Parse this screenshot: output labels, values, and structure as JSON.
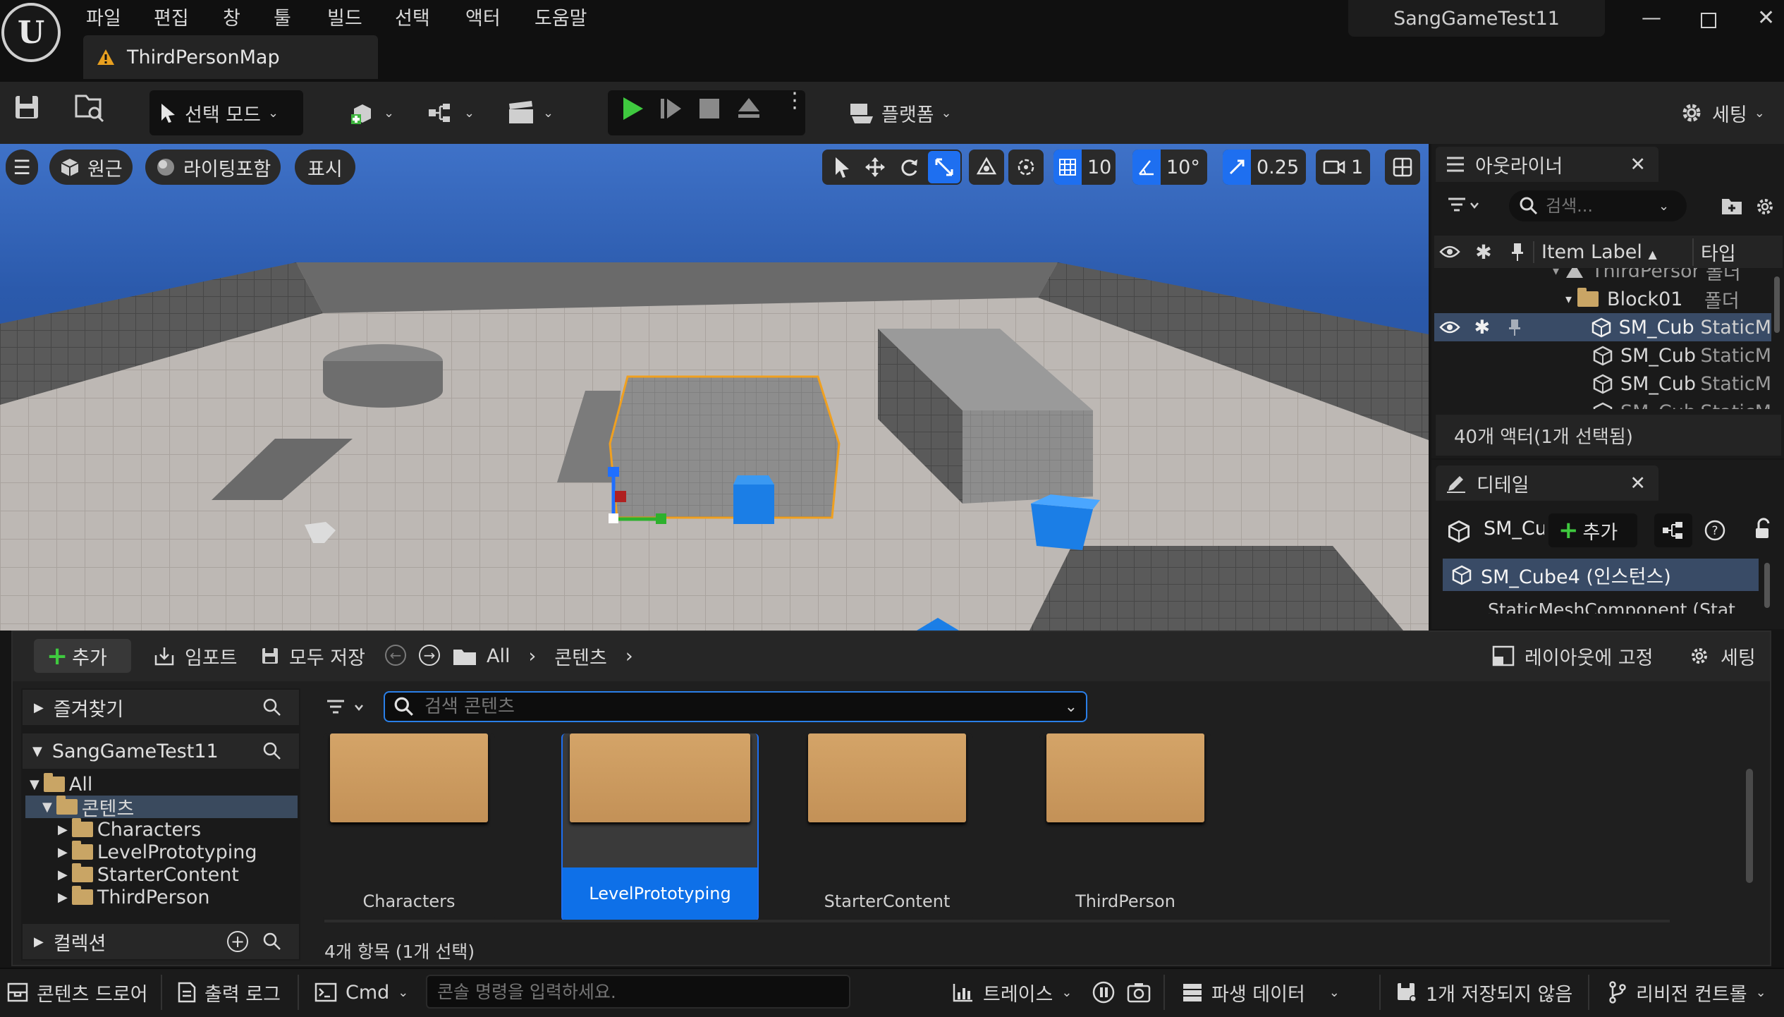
{
  "menu": [
    "파일",
    "편집",
    "창",
    "툴",
    "빌드",
    "선택",
    "액터",
    "도움말"
  ],
  "map_tab": "ThirdPersonMap",
  "project_name": "SangGameTest11",
  "toolbar": {
    "select_mode": "선택 모드",
    "platform": "플랫폼",
    "settings": "세팅"
  },
  "viewport": {
    "perspective": "원근",
    "lighting": "라이팅포함",
    "show": "표시",
    "grid_snap": "10",
    "rotation_snap": "10°",
    "scale_snap": "0.25",
    "camera_speed": "1"
  },
  "outliner": {
    "title": "아웃라이너",
    "search_placeholder": "검색...",
    "col_label": "Item Label",
    "col_type": "타입",
    "rows": [
      {
        "label": "ThirdPerson",
        "type": "폴더"
      },
      {
        "label": "Block01",
        "type": "폴더"
      },
      {
        "label": "SM_Cub",
        "type": "StaticM"
      },
      {
        "label": "SM_Cub",
        "type": "StaticM"
      },
      {
        "label": "SM_Cub",
        "type": "StaticM"
      },
      {
        "label": "SM_Cub",
        "type": "StaticM"
      }
    ],
    "count": "40개 액터(1개 선택됨)"
  },
  "details": {
    "title": "디테일",
    "actor_name": "SM_Cu",
    "add_label": "추가",
    "instance_label": "SM_Cube4 (인스턴스)",
    "component_label": "StaticMeshComponent (Stat"
  },
  "content_browser": {
    "add": "추가",
    "import": "임포트",
    "save_all": "모두 저장",
    "path": [
      "All",
      "콘텐츠"
    ],
    "dock_layout": "레이아웃에 고정",
    "settings": "세팅",
    "favorites": "즐겨찾기",
    "project": "SangGameTest11",
    "tree": [
      "All",
      "콘텐츠",
      "Characters",
      "LevelPrototyping",
      "StarterContent",
      "ThirdPerson"
    ],
    "collections": "컬렉션",
    "search_placeholder": "검색 콘텐츠",
    "assets": [
      "Characters",
      "LevelPrototyping",
      "StarterContent",
      "ThirdPerson"
    ],
    "selected_index": 1,
    "item_count": "4개 항목 (1개 선택)"
  },
  "statusbar": {
    "content_drawer": "콘텐츠 드로어",
    "output_log": "출력 로그",
    "cmd": "Cmd",
    "console_placeholder": "콘솔 명령을 입력하세요.",
    "trace": "트레이스",
    "derived_data": "파생 데이터",
    "unsaved": "1개 저장되지 않음",
    "revision_control": "리비전 컨트롤"
  }
}
